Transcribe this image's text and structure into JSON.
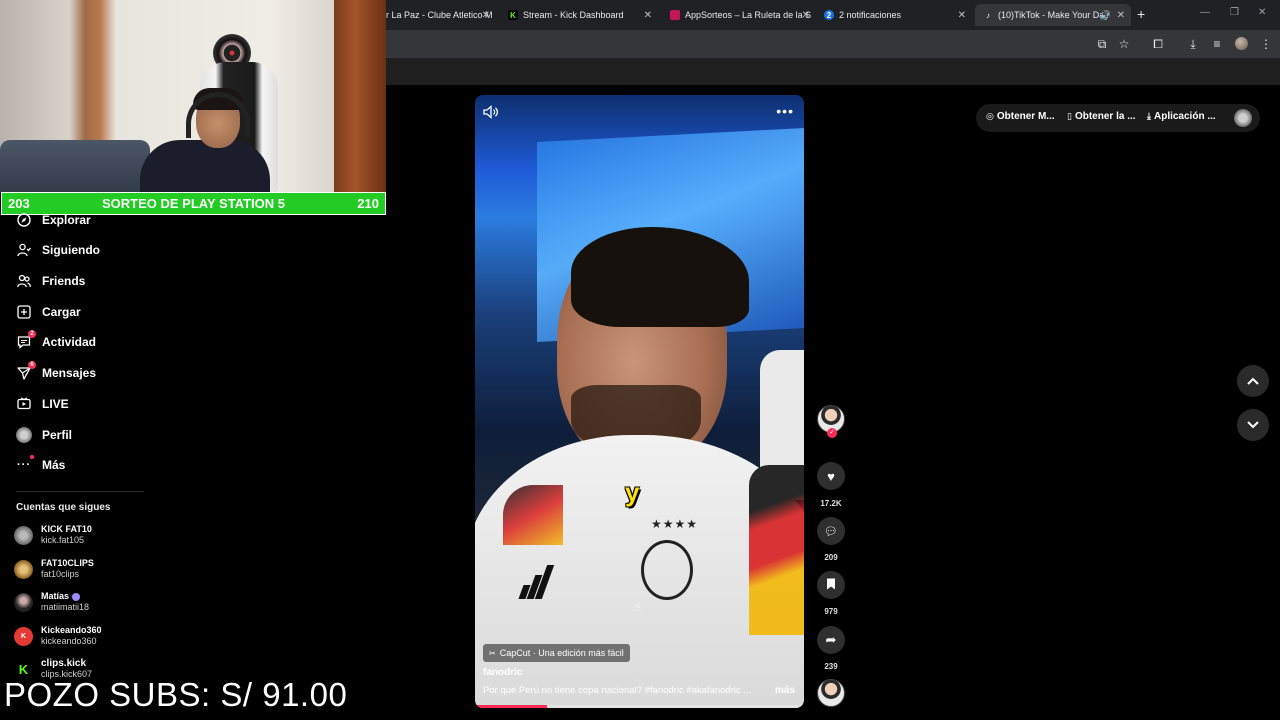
{
  "browser": {
    "tabs": [
      {
        "title": "r La Paz - Clube Atletico M",
        "fav": "",
        "color": "#5f6368"
      },
      {
        "title": "Stream - Kick Dashboard",
        "fav": "K",
        "color": "#53fc18"
      },
      {
        "title": "AppSorteos – La Ruleta de la S",
        "fav": "",
        "color": "#c2185b"
      },
      {
        "title": "2 notificaciones",
        "fav": "2",
        "color": "#1a73e8"
      },
      {
        "title": "(10)TikTok - Make Your Day",
        "fav": "♪",
        "color": "#ffffff"
      }
    ]
  },
  "stream": {
    "raffle_left": "203",
    "raffle_title": "SORTEO DE PLAY STATION 5",
    "raffle_right": "210",
    "pozo": "POZO SUBS: S/ 91.00"
  },
  "sidebar": {
    "items": [
      {
        "label": "Explorar",
        "icon": "compass-icon",
        "glyph": "◎"
      },
      {
        "label": "Siguiendo",
        "icon": "following-icon",
        "glyph": "⚇"
      },
      {
        "label": "Friends",
        "icon": "friends-icon",
        "glyph": "⚉"
      },
      {
        "label": "Cargar",
        "icon": "upload-icon",
        "glyph": "⊞"
      },
      {
        "label": "Actividad",
        "icon": "activity-icon",
        "glyph": "▭",
        "badge": "2"
      },
      {
        "label": "Mensajes",
        "icon": "messages-icon",
        "glyph": "▽",
        "badge": "6"
      },
      {
        "label": "LIVE",
        "icon": "live-icon",
        "glyph": "▣"
      },
      {
        "label": "Perfil",
        "icon": "profile-icon",
        "glyph": "●"
      },
      {
        "label": "Más",
        "icon": "more-icon",
        "glyph": "···",
        "dot": true
      }
    ],
    "following_title": "Cuentas que sigues",
    "following": [
      {
        "name": "KICK FAT10",
        "handle": "kick.fat105",
        "color": "#8a8a8a"
      },
      {
        "name": "FAT10CLIPS",
        "handle": "fat10clips",
        "color": "#b08850"
      },
      {
        "name": "Matías",
        "handle": "matiimatii18",
        "color": "#3a3a3a"
      },
      {
        "name": "Kickeando360",
        "handle": "kickeando360",
        "color": "#e53935"
      },
      {
        "name": "clips.kick",
        "handle": "clips.kick607",
        "color": "#53fc18"
      }
    ]
  },
  "video": {
    "caption_word": "y",
    "capcut": "CapCut · Una edición más fácil",
    "author": "fanodric",
    "description": "Por qué Perú no tiene copa nacional? #fanodric #akafanodric ...",
    "more_label": "más",
    "progress": 0.22
  },
  "actions": {
    "likes": "17.2K",
    "comments": "209",
    "saves": "979",
    "shares": "239"
  },
  "topbar": {
    "item1": "Obtener M...",
    "item2": "Obtener la ...",
    "item3": "Aplicación ..."
  }
}
